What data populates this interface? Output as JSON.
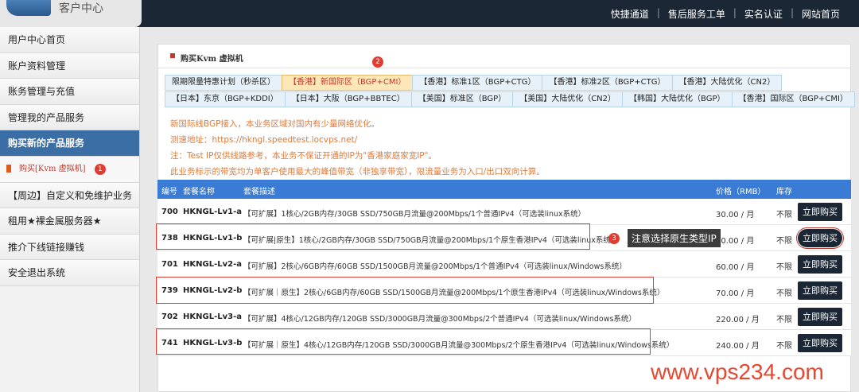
{
  "header": {
    "logo_text": "客户中心",
    "nav": [
      "快捷通道",
      "售后服务工单",
      "实名认证",
      "网站首页"
    ]
  },
  "sidebar": {
    "items": [
      {
        "label": "用户中心首页"
      },
      {
        "label": "账户资料管理"
      },
      {
        "label": "账务管理与充值"
      },
      {
        "label": "管理我的产品服务"
      },
      {
        "label": "购买新的产品服务"
      },
      {
        "label": "购买[Kvm 虚拟机]"
      },
      {
        "label": "【周边】自定义和免维护业务"
      },
      {
        "label": "租用★裸金属服务器★"
      },
      {
        "label": "推介下线链接赚钱"
      },
      {
        "label": "安全退出系统"
      }
    ],
    "sub_badge": "1"
  },
  "panel": {
    "title": "购买Kvm 虚拟机",
    "tabs_badge": "2",
    "tabs_row1": [
      "限期限量特惠计划（秒杀区）",
      "【香港】新国际区（BGP+CMI）",
      "【香港】标准1区（BGP+CTG）",
      "【香港】标准2区（BGP+CTG）",
      "【香港】大陆优化（CN2）"
    ],
    "tabs_row2": [
      "【日本】东京（BGP+KDDI）",
      "【日本】大阪（BGP+BBTEC）",
      "【美国】标准区（BGP）",
      "【美国】大陆优化（CN2）",
      "【韩国】大陆优化（BGP）",
      "【香港】国际区（BGP+CMI）"
    ],
    "notes": [
      "新国际线BGP接入，本业务区域对国内有少量网络优化。",
      "测速地址：https://hkngl.speedtest.locvps.net/",
      "注：Test IP仅供线路参考，本业务不保证开通的IP为\"香港家庭家宽IP\"。",
      "此业务标示的带宽均为单客户使用最大的峰值带宽（非独享带宽），限流量业务为入口/出口双向计算。"
    ]
  },
  "table": {
    "headers": {
      "id": "编号",
      "name": "套餐名称",
      "desc": "套餐描述",
      "price": "价格（RMB）",
      "stock": "库存"
    },
    "rows": [
      {
        "id": "700",
        "name": "HKNGL-Lv1-a",
        "desc": "【可扩展】1核心/2GB内存/30GB SSD/750GB月流量@200Mbps/1个普通IPv4（可选装linux系统）",
        "price": "30.00 / 月",
        "stock": "不限",
        "action": "立即购买"
      },
      {
        "id": "738",
        "name": "HKNGL-Lv1-b",
        "desc": "【可扩展|原生】1核心/2GB内存/30GB SSD/750GB月流量@200Mbps/1个原生香港IPv4（可选装linux系统）",
        "price": "40.00 / 月",
        "stock": "不限",
        "action": "立即购买"
      },
      {
        "id": "701",
        "name": "HKNGL-Lv2-a",
        "desc": "【可扩展】2核心/6GB内存/60GB SSD/1500GB月流量@200Mbps/1个普通IPv4（可选装linux/Windows系统）",
        "price": "60.00 / 月",
        "stock": "不限",
        "action": "立即购买"
      },
      {
        "id": "739",
        "name": "HKNGL-Lv2-b",
        "desc": "【可扩展｜原生】2核心/6GB内存/60GB SSD/1500GB月流量@200Mbps/1个原生香港IPv4（可选装linux/Windows系统）",
        "price": "70.00 / 月",
        "stock": "不限",
        "action": "立即购买"
      },
      {
        "id": "702",
        "name": "HKNGL-Lv3-a",
        "desc": "【可扩展】4核心/12GB内存/120GB SSD/3000GB月流量@300Mbps/2个普通IPv4（可选装linux/Windows系统）",
        "price": "220.00 / 月",
        "stock": "不限",
        "action": "立即购买"
      },
      {
        "id": "741",
        "name": "HKNGL-Lv3-b",
        "desc": "【可扩展｜原生】4核心/12GB内存/120GB SSD/3000GB月流量@300Mbps/2个原生香港IPv4（可选装linux/Windows系统）",
        "price": "240.00 / 月",
        "stock": "不限",
        "action": "立即购买"
      }
    ]
  },
  "annotation": {
    "badge": "3",
    "text": "注意选择原生类型IP"
  },
  "watermark": "www.vps234.com"
}
